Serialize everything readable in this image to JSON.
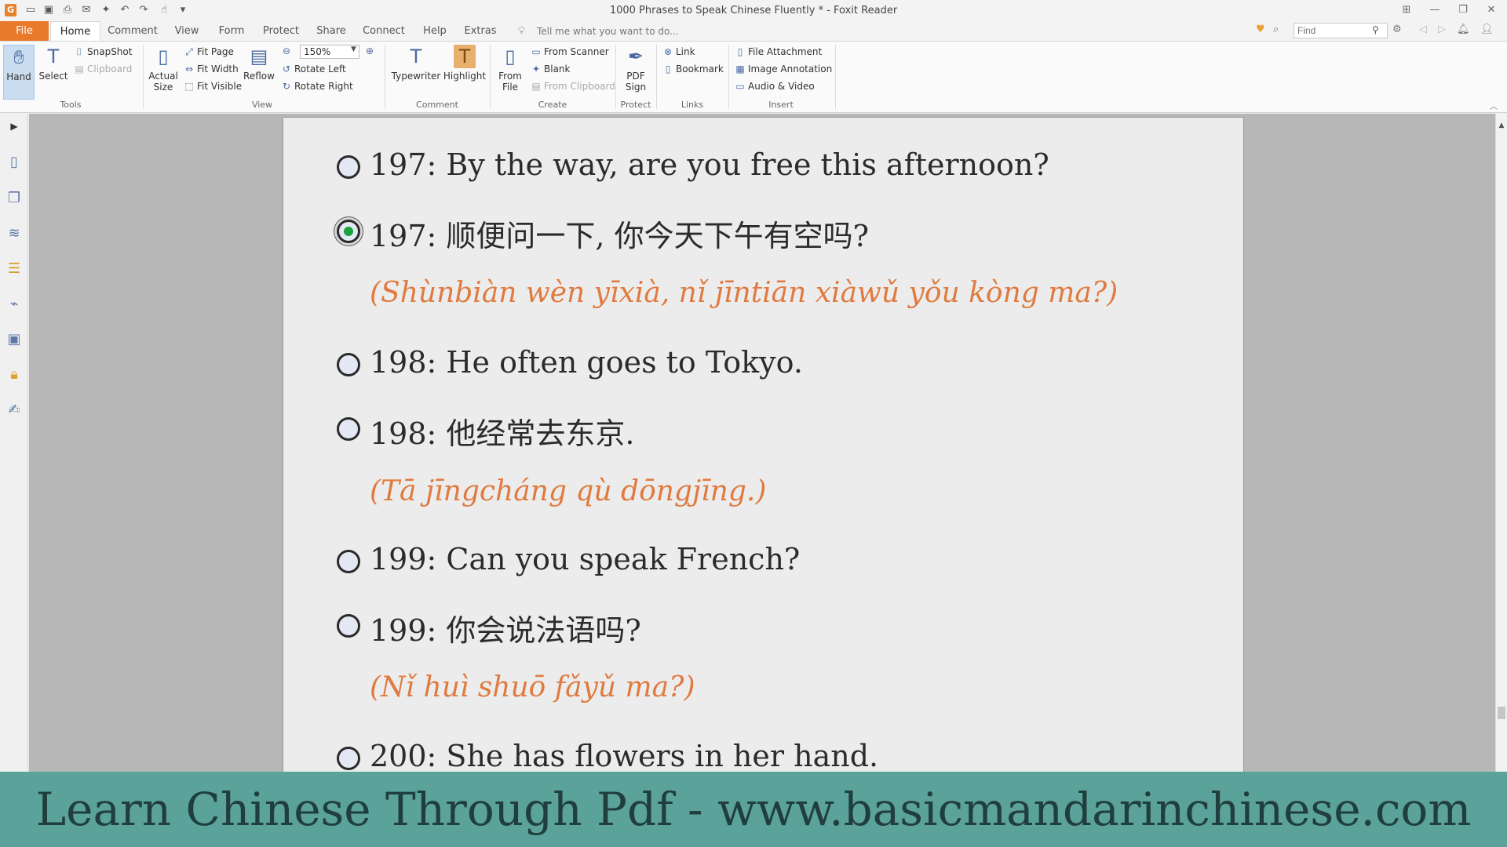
{
  "window": {
    "title": "1000 Phrases to Speak Chinese Fluently * - Foxit Reader",
    "logo": "G",
    "quick_access": [
      "open-icon",
      "save-icon",
      "print-icon",
      "email-icon",
      "new-icon",
      "undo-icon",
      "redo-icon",
      "hand-tool-icon",
      "customize-icon"
    ]
  },
  "tabs": [
    "File",
    "Home",
    "Comment",
    "View",
    "Form",
    "Protect",
    "Share",
    "Connect",
    "Help",
    "Extras"
  ],
  "tell_me": "Tell me what you want to do...",
  "find": {
    "placeholder": "Find"
  },
  "ribbon": {
    "tools": {
      "label": "Tools",
      "hand": "Hand",
      "select": "Select",
      "snapshot": "SnapShot",
      "clipboard": "Clipboard"
    },
    "view": {
      "label": "View",
      "actual_size_1": "Actual",
      "actual_size_2": "Size",
      "fit_page": "Fit Page",
      "fit_width": "Fit Width",
      "fit_visible": "Fit Visible",
      "reflow": "Reflow",
      "zoom": "150%",
      "rotate_left": "Rotate Left",
      "rotate_right": "Rotate Right"
    },
    "comment": {
      "label": "Comment",
      "typewriter": "Typewriter",
      "highlight": "Highlight"
    },
    "create": {
      "label": "Create",
      "from_file_1": "From",
      "from_file_2": "File",
      "from_scanner": "From Scanner",
      "blank": "Blank",
      "from_clipboard": "From Clipboard"
    },
    "protect": {
      "label": "Protect",
      "pdf_sign_1": "PDF",
      "pdf_sign_2": "Sign"
    },
    "links": {
      "label": "Links",
      "link": "Link",
      "bookmark": "Bookmark"
    },
    "insert": {
      "label": "Insert",
      "file_attachment": "File Attachment",
      "image_annotation": "Image Annotation",
      "audio_video": "Audio & Video"
    }
  },
  "document": {
    "phrases": [
      {
        "text": "197: By the way, are you free this afternoon?",
        "checked": false
      },
      {
        "text": "197: 顺便问一下, 你今天下午有空吗?",
        "checked": true
      },
      {
        "pinyin": "(Shùnbiàn wèn yīxià, nǐ jīntiān xiàwǔ yǒu kòng ma?)"
      },
      {
        "text": "198: He often goes to Tokyo.",
        "checked": false
      },
      {
        "text": "198: 他经常去东京.",
        "checked": false
      },
      {
        "pinyin": "(Tā jīngcháng qù dōngjīng.)"
      },
      {
        "text": "199: Can you speak French?",
        "checked": false
      },
      {
        "text": "199: 你会说法语吗?",
        "checked": false
      },
      {
        "pinyin": "(Nǐ huì shuō fǎyǔ ma?)"
      },
      {
        "text": "200: She has flowers in her hand.",
        "checked": false
      }
    ]
  },
  "banner": "Learn Chinese Through Pdf - www.basicmandarinchinese.com",
  "colors": {
    "accent": "#ea7a2b",
    "pinyin": "#e07a3e",
    "banner": "#5ba29a",
    "banner_text": "#1f3e3d"
  }
}
